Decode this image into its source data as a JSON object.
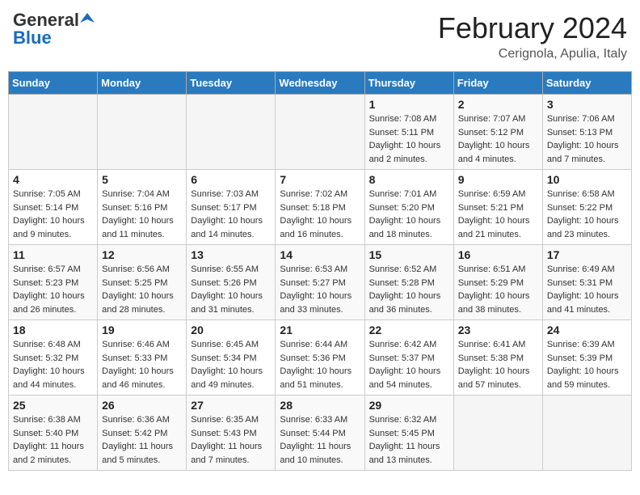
{
  "header": {
    "logo_general": "General",
    "logo_blue": "Blue",
    "month_title": "February 2024",
    "location": "Cerignola, Apulia, Italy"
  },
  "days_of_week": [
    "Sunday",
    "Monday",
    "Tuesday",
    "Wednesday",
    "Thursday",
    "Friday",
    "Saturday"
  ],
  "weeks": [
    [
      {
        "day": "",
        "details": ""
      },
      {
        "day": "",
        "details": ""
      },
      {
        "day": "",
        "details": ""
      },
      {
        "day": "",
        "details": ""
      },
      {
        "day": "1",
        "details": "Sunrise: 7:08 AM\nSunset: 5:11 PM\nDaylight: 10 hours\nand 2 minutes."
      },
      {
        "day": "2",
        "details": "Sunrise: 7:07 AM\nSunset: 5:12 PM\nDaylight: 10 hours\nand 4 minutes."
      },
      {
        "day": "3",
        "details": "Sunrise: 7:06 AM\nSunset: 5:13 PM\nDaylight: 10 hours\nand 7 minutes."
      }
    ],
    [
      {
        "day": "4",
        "details": "Sunrise: 7:05 AM\nSunset: 5:14 PM\nDaylight: 10 hours\nand 9 minutes."
      },
      {
        "day": "5",
        "details": "Sunrise: 7:04 AM\nSunset: 5:16 PM\nDaylight: 10 hours\nand 11 minutes."
      },
      {
        "day": "6",
        "details": "Sunrise: 7:03 AM\nSunset: 5:17 PM\nDaylight: 10 hours\nand 14 minutes."
      },
      {
        "day": "7",
        "details": "Sunrise: 7:02 AM\nSunset: 5:18 PM\nDaylight: 10 hours\nand 16 minutes."
      },
      {
        "day": "8",
        "details": "Sunrise: 7:01 AM\nSunset: 5:20 PM\nDaylight: 10 hours\nand 18 minutes."
      },
      {
        "day": "9",
        "details": "Sunrise: 6:59 AM\nSunset: 5:21 PM\nDaylight: 10 hours\nand 21 minutes."
      },
      {
        "day": "10",
        "details": "Sunrise: 6:58 AM\nSunset: 5:22 PM\nDaylight: 10 hours\nand 23 minutes."
      }
    ],
    [
      {
        "day": "11",
        "details": "Sunrise: 6:57 AM\nSunset: 5:23 PM\nDaylight: 10 hours\nand 26 minutes."
      },
      {
        "day": "12",
        "details": "Sunrise: 6:56 AM\nSunset: 5:25 PM\nDaylight: 10 hours\nand 28 minutes."
      },
      {
        "day": "13",
        "details": "Sunrise: 6:55 AM\nSunset: 5:26 PM\nDaylight: 10 hours\nand 31 minutes."
      },
      {
        "day": "14",
        "details": "Sunrise: 6:53 AM\nSunset: 5:27 PM\nDaylight: 10 hours\nand 33 minutes."
      },
      {
        "day": "15",
        "details": "Sunrise: 6:52 AM\nSunset: 5:28 PM\nDaylight: 10 hours\nand 36 minutes."
      },
      {
        "day": "16",
        "details": "Sunrise: 6:51 AM\nSunset: 5:29 PM\nDaylight: 10 hours\nand 38 minutes."
      },
      {
        "day": "17",
        "details": "Sunrise: 6:49 AM\nSunset: 5:31 PM\nDaylight: 10 hours\nand 41 minutes."
      }
    ],
    [
      {
        "day": "18",
        "details": "Sunrise: 6:48 AM\nSunset: 5:32 PM\nDaylight: 10 hours\nand 44 minutes."
      },
      {
        "day": "19",
        "details": "Sunrise: 6:46 AM\nSunset: 5:33 PM\nDaylight: 10 hours\nand 46 minutes."
      },
      {
        "day": "20",
        "details": "Sunrise: 6:45 AM\nSunset: 5:34 PM\nDaylight: 10 hours\nand 49 minutes."
      },
      {
        "day": "21",
        "details": "Sunrise: 6:44 AM\nSunset: 5:36 PM\nDaylight: 10 hours\nand 51 minutes."
      },
      {
        "day": "22",
        "details": "Sunrise: 6:42 AM\nSunset: 5:37 PM\nDaylight: 10 hours\nand 54 minutes."
      },
      {
        "day": "23",
        "details": "Sunrise: 6:41 AM\nSunset: 5:38 PM\nDaylight: 10 hours\nand 57 minutes."
      },
      {
        "day": "24",
        "details": "Sunrise: 6:39 AM\nSunset: 5:39 PM\nDaylight: 10 hours\nand 59 minutes."
      }
    ],
    [
      {
        "day": "25",
        "details": "Sunrise: 6:38 AM\nSunset: 5:40 PM\nDaylight: 11 hours\nand 2 minutes."
      },
      {
        "day": "26",
        "details": "Sunrise: 6:36 AM\nSunset: 5:42 PM\nDaylight: 11 hours\nand 5 minutes."
      },
      {
        "day": "27",
        "details": "Sunrise: 6:35 AM\nSunset: 5:43 PM\nDaylight: 11 hours\nand 7 minutes."
      },
      {
        "day": "28",
        "details": "Sunrise: 6:33 AM\nSunset: 5:44 PM\nDaylight: 11 hours\nand 10 minutes."
      },
      {
        "day": "29",
        "details": "Sunrise: 6:32 AM\nSunset: 5:45 PM\nDaylight: 11 hours\nand 13 minutes."
      },
      {
        "day": "",
        "details": ""
      },
      {
        "day": "",
        "details": ""
      }
    ]
  ]
}
